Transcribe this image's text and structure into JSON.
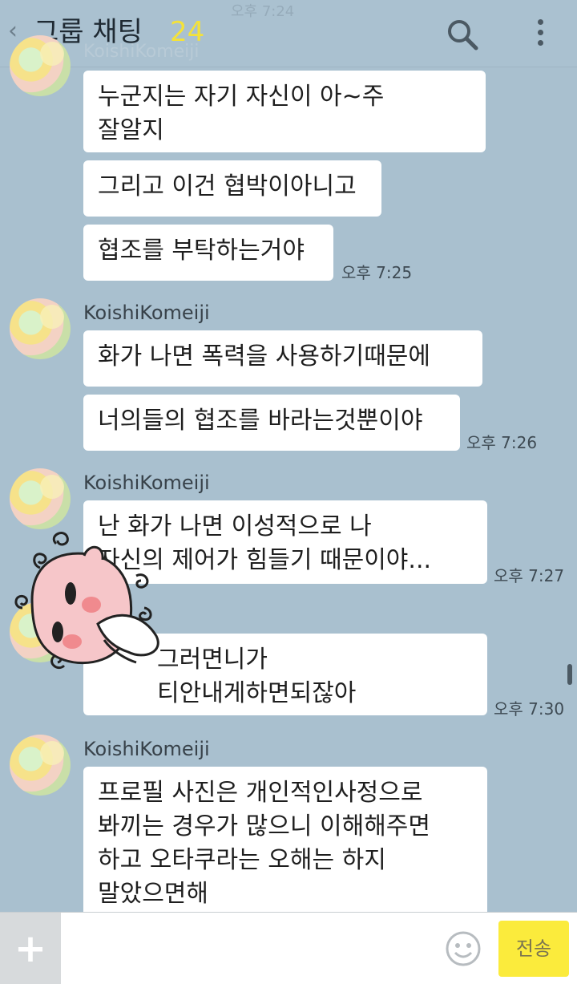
{
  "header": {
    "back_glyph": "‹",
    "title": "그룹 채팅",
    "member_count": "24",
    "faded_time": "오후 7:24",
    "icons": [
      "search-icon",
      "more-vertical-icon"
    ]
  },
  "faded_name": "KoishiKomeiji",
  "messages": [
    {
      "bubbles": [
        "누군지는 자기 자신이 아~주\n잘알지",
        "그리고 이건 협박이아니고",
        "협조를 부탁하는거야"
      ],
      "time": "오후 7:25"
    },
    {
      "sender": "KoishiKomeiji",
      "bubbles": [
        "화가 나면 폭력을 사용하기때문에",
        "너의들의 협조를 바라는것뿐이야"
      ],
      "time": "오후 7:26"
    },
    {
      "sender": "KoishiKomeiji",
      "bubbles": [
        "난 화가 나면 이성적으로 나\n자신의 제어가 힘들기 때문이야..."
      ],
      "time": "오후 7:27"
    },
    {
      "bubbles": [
        "그러면니가\n티안내게하면되잖아"
      ],
      "time": "오후 7:30"
    },
    {
      "sender": "KoishiKomeiji",
      "bubbles": [
        "프로필 사진은 개인적인사정으로\n봐끼는 경우가 많으니 이해해주면\n하고 오타쿠라는 오해는 하지\n말았으면해"
      ]
    }
  ],
  "composer": {
    "plus_label": "+",
    "input_placeholder": "",
    "send_label": "전송",
    "icons": [
      "emoji-icon"
    ]
  },
  "colors": {
    "background": "#a9c0cf",
    "bubble": "#ffffff",
    "send_button": "#fbeb3c",
    "member_count": "#f4e23a"
  }
}
